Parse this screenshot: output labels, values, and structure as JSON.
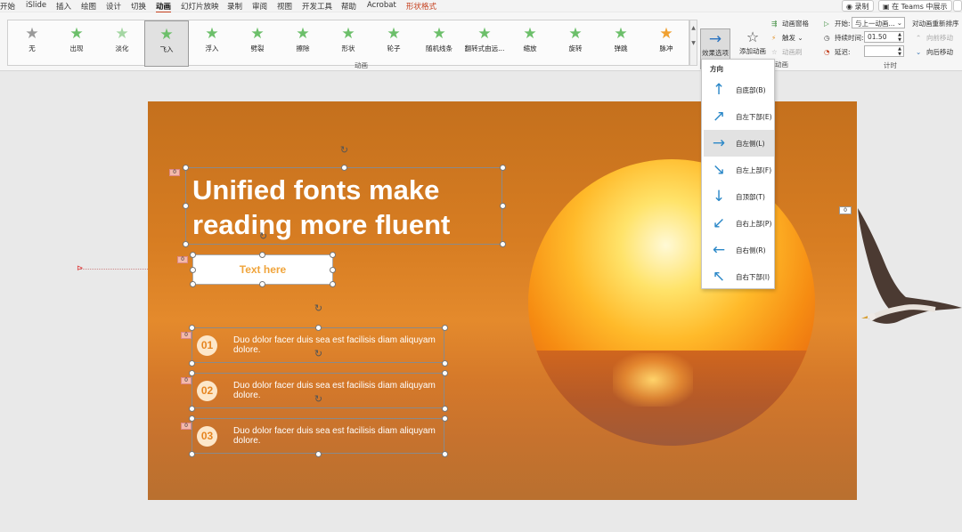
{
  "menu": {
    "tabs": [
      "开始",
      "iSlide",
      "插入",
      "绘图",
      "设计",
      "切换",
      "动画",
      "幻灯片放映",
      "录制",
      "审阅",
      "视图",
      "开发工具",
      "帮助",
      "Acrobat",
      "形状格式"
    ],
    "record_btn": "录制",
    "teams_btn": "在 Teams 中展示"
  },
  "ribbon": {
    "animations": [
      "无",
      "出现",
      "淡化",
      "飞入",
      "浮入",
      "劈裂",
      "擦除",
      "形状",
      "轮子",
      "随机线条",
      "翻转式由远...",
      "缩放",
      "旋转",
      "弹跳",
      "脉冲"
    ],
    "group_animation": "动画",
    "effect_options": "效果选项",
    "add_animation": "添加动画",
    "animation_pane": "动画窗格",
    "trigger": "触发",
    "animation_painter": "动画刷",
    "group_advanced": "动画",
    "start_label": "开始:",
    "start_value": "与上一动画...",
    "duration_label": "持续时间:",
    "duration_value": "01.50",
    "delay_label": "延迟:",
    "delay_value": "",
    "reorder_title": "对动画重新排序",
    "move_earlier": "向前移动",
    "move_later": "向后移动",
    "group_timing": "计时"
  },
  "direction_menu": {
    "header": "方向",
    "options": [
      "自底部(B)",
      "自左下部(E)",
      "自左侧(L)",
      "自左上部(F)",
      "自顶部(T)",
      "自右上部(P)",
      "自右侧(R)",
      "自右下部(I)"
    ],
    "selected": "自左侧(L)"
  },
  "slide": {
    "title_line1": "Unified fonts make",
    "title_line2": "reading more fluent",
    "subtitle": "Text here",
    "items": [
      {
        "num": "01",
        "text": "Duo dolor facer duis sea est facilisis diam aliquyam dolore."
      },
      {
        "num": "02",
        "text": "Duo dolor facer duis sea est facilisis diam aliquyam dolore."
      },
      {
        "num": "03",
        "text": "Duo dolor facer duis sea est facilisis diam aliquyam dolore."
      }
    ],
    "anim_tag": "0"
  }
}
